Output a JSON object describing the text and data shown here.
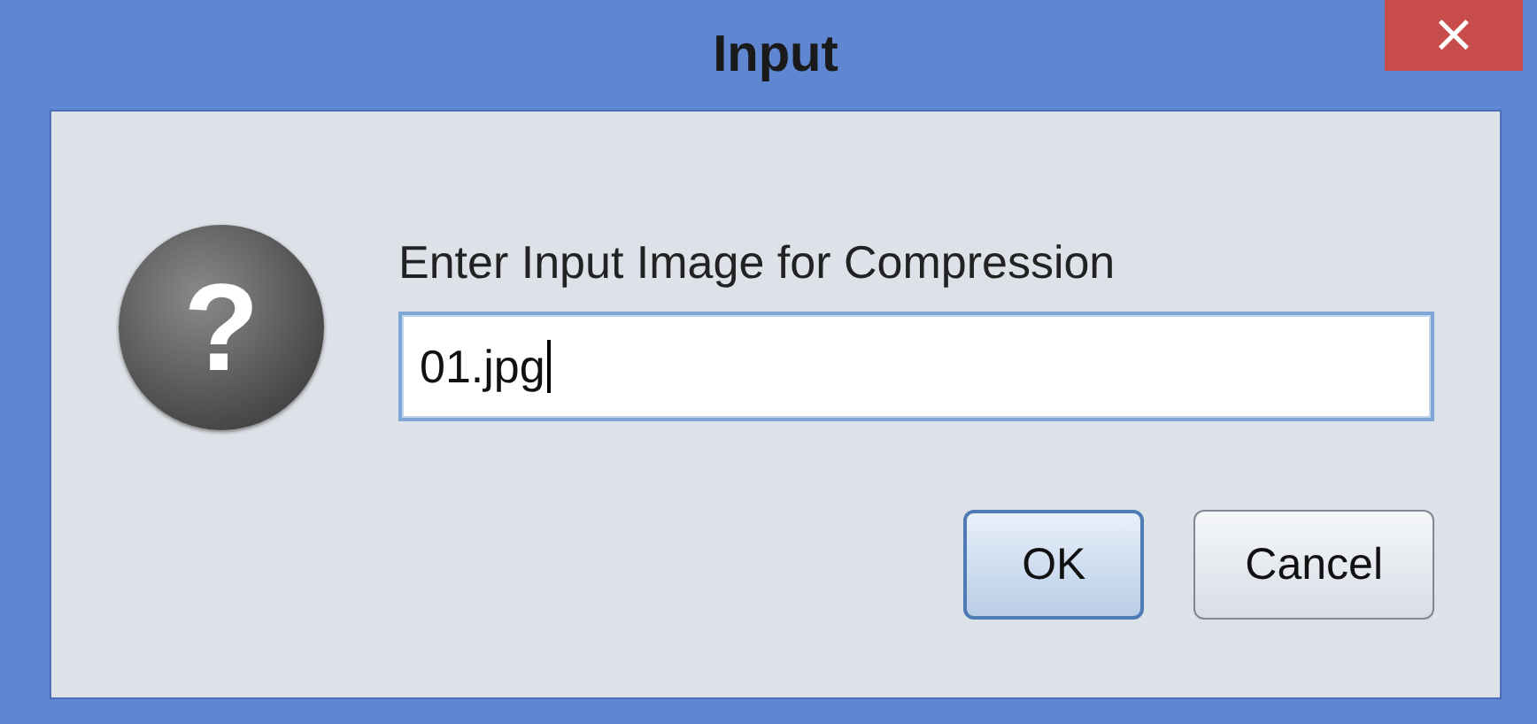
{
  "window": {
    "title": "Input",
    "close_glyph": "×"
  },
  "icon": {
    "glyph": "?"
  },
  "message": "Enter Input Image for Compression",
  "field": {
    "value": "01.jpg",
    "focused": true
  },
  "buttons": [
    {
      "label": "OK",
      "default": true
    },
    {
      "label": "Cancel",
      "default": false
    }
  ]
}
